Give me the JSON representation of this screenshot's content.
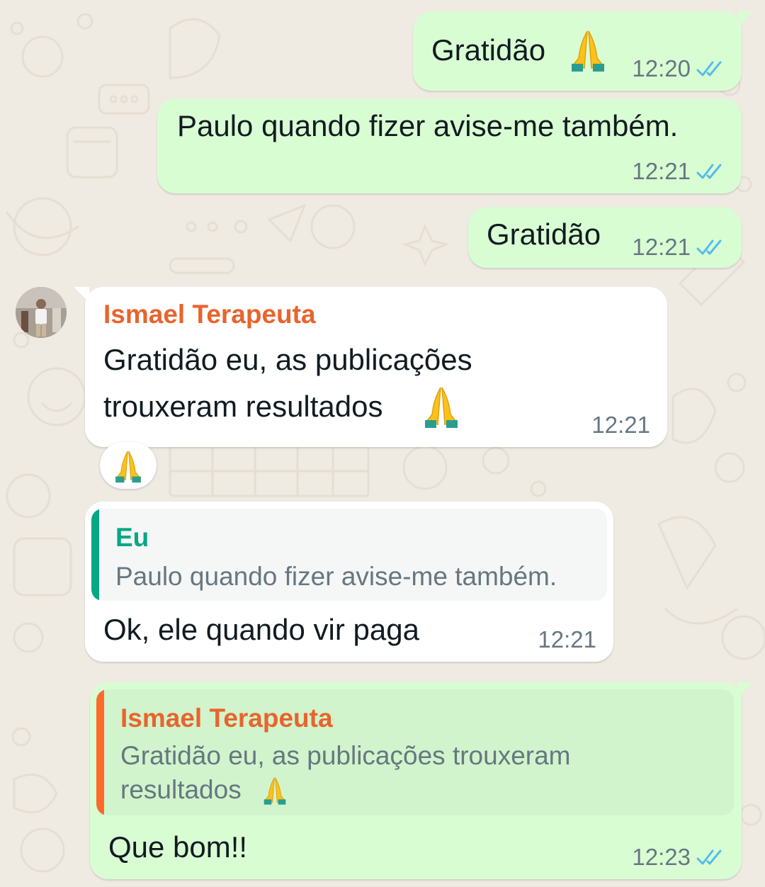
{
  "colors": {
    "wallpaper": "#efeae2",
    "outgoing_bubble": "#d9fdd3",
    "incoming_bubble": "#ffffff",
    "read_ticks": "#53bdeb",
    "sender_name": "#e8642d",
    "self_name": "#06a884",
    "timestamp": "#667781"
  },
  "messages": [
    {
      "direction": "outgoing",
      "text": "Gratidão",
      "emoji": "folded-hands-icon",
      "time": "12:20",
      "status": "read"
    },
    {
      "direction": "outgoing",
      "text": "Paulo quando fizer avise-me também.",
      "time": "12:21",
      "status": "read"
    },
    {
      "direction": "outgoing",
      "text": "Gratidão",
      "time": "12:21",
      "status": "read"
    },
    {
      "direction": "incoming",
      "sender": "Ismael Terapeuta",
      "lines": [
        "Gratidão eu, as publicações",
        "trouxeram resultados"
      ],
      "emoji": "folded-hands-icon",
      "time": "12:21",
      "reaction": "folded-hands-icon"
    },
    {
      "direction": "incoming",
      "quote": {
        "name": "Eu",
        "text": "Paulo quando fizer avise-me também."
      },
      "text": "Ok, ele quando vir paga",
      "time": "12:21"
    },
    {
      "direction": "outgoing",
      "quote": {
        "name": "Ismael Terapeuta",
        "lines": [
          "Gratidão eu, as publicações trouxeram",
          "resultados"
        ],
        "emoji": "folded-hands-icon"
      },
      "text": "Que bom!!",
      "time": "12:23",
      "status": "read"
    }
  ]
}
